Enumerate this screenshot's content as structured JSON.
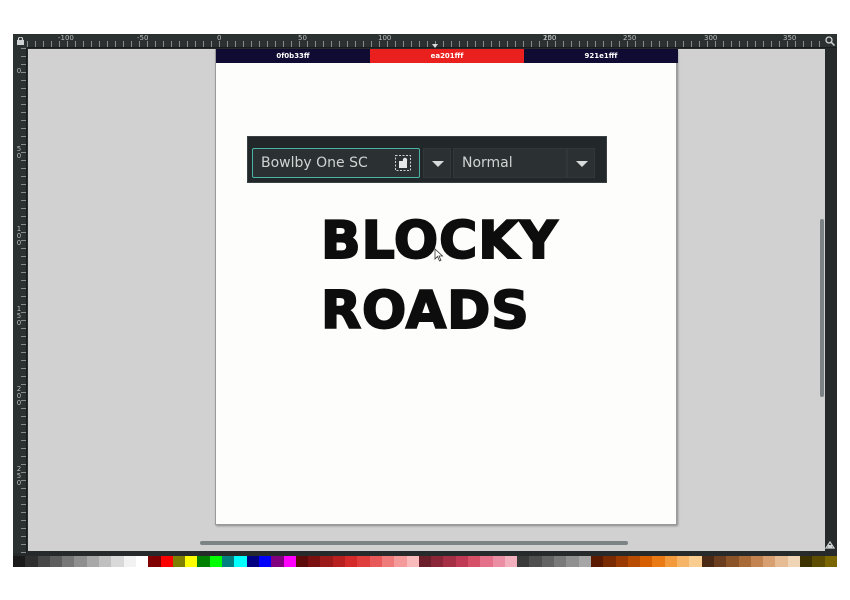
{
  "ruler": {
    "top_labels": [
      "-100",
      "-50",
      "0",
      "50",
      "100",
      "150",
      "200",
      "250",
      "300",
      "350"
    ],
    "left_labels": [
      "0",
      "5\n0",
      "1\n0\n0",
      "1\n5\n0",
      "2\n0\n0",
      "2\n5\n0"
    ]
  },
  "page_swatches": [
    {
      "label": "0f0b33ff",
      "color": "#0f0b33"
    },
    {
      "label": "ea201fff",
      "color": "#ea201f"
    },
    {
      "label": "921e1fff",
      "color": "#0f0b33"
    }
  ],
  "font_toolbar": {
    "family_value": "Bowlby One SC",
    "style_value": "Normal"
  },
  "canvas_text": {
    "line1": "BLOCKY",
    "line2": "ROADS"
  },
  "palette_colors": [
    "#1a1a1a",
    "#2f2f2f",
    "#474747",
    "#5e5e5e",
    "#777777",
    "#8f8f8f",
    "#a8a8a8",
    "#c0c0c0",
    "#d9d9d9",
    "#f2f2f2",
    "#ffffff",
    "#800000",
    "#ff0000",
    "#808000",
    "#ffff00",
    "#008000",
    "#00ff00",
    "#008080",
    "#00ffff",
    "#000080",
    "#0000ff",
    "#800080",
    "#ff00ff",
    "#5c0a0a",
    "#7a1010",
    "#9c1a1a",
    "#b82020",
    "#d42a2a",
    "#e03d3d",
    "#e85a5a",
    "#ef7a7a",
    "#f49a9a",
    "#f8baba",
    "#6b1f2b",
    "#8a2638",
    "#a52f45",
    "#c03a55",
    "#d65068",
    "#e4708a",
    "#eb8ea3",
    "#f2afbd",
    "#3a3a3a",
    "#4f4f4f",
    "#646464",
    "#7a7a7a",
    "#909090",
    "#a6a6a6",
    "#5a1a00",
    "#7a2a00",
    "#9a3a00",
    "#b84c00",
    "#d66000",
    "#ea7a14",
    "#f29a3c",
    "#f6b466",
    "#f9cc90",
    "#4a2a14",
    "#6a3e1e",
    "#8a5428",
    "#a86a36",
    "#c48452",
    "#d8a070",
    "#e6bc94",
    "#f0d4b6",
    "#3d3300",
    "#5c4d00",
    "#7a6600"
  ]
}
